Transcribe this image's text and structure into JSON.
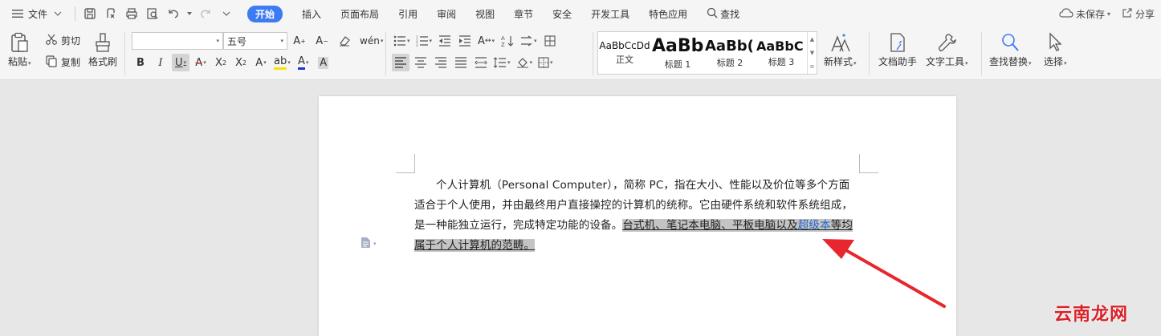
{
  "menubar": {
    "file_label": "文件",
    "tabs": [
      {
        "label": "开始",
        "active": true
      },
      {
        "label": "插入"
      },
      {
        "label": "页面布局"
      },
      {
        "label": "引用"
      },
      {
        "label": "审阅"
      },
      {
        "label": "视图"
      },
      {
        "label": "章节"
      },
      {
        "label": "安全"
      },
      {
        "label": "开发工具"
      },
      {
        "label": "特色应用"
      }
    ],
    "search_label": "查找",
    "unsaved_label": "未保存",
    "share_label": "分享"
  },
  "ribbon": {
    "paste_label": "粘贴",
    "cut_label": "剪切",
    "copy_label": "复制",
    "format_painter_label": "格式刷",
    "font_name_value": "",
    "font_size_value": "五号",
    "styles": [
      {
        "sample": "AaBbCcDd",
        "label": "正文"
      },
      {
        "sample": "AaBb",
        "label": "标题 1"
      },
      {
        "sample": "AaBb(",
        "label": "标题 2"
      },
      {
        "sample": "AaBbC",
        "label": "标题 3"
      }
    ],
    "new_style_label": "新样式",
    "doc_helper_label": "文档助手",
    "text_tools_label": "文字工具",
    "find_replace_label": "查找替换",
    "select_label": "选择"
  },
  "document": {
    "para_normal": "个人计算机（Personal Computer），简称 PC，指在大小、性能以及价位等多个方面适合于个人使用，并由最终用户直接操控的计算机的统称。它由硬件系统和软件系统组成，是一种能独立运行，完成特定功能的设备。",
    "sel_part1": "台式机、笔记本电脑、平板电脑以及",
    "sel_link": "超级本",
    "sel_part2": "等均属于个人计算机的范畴。"
  },
  "watermark": "云南龙网",
  "colors": {
    "accent": "#3d7bf2",
    "selection": "#c4c4c4",
    "link": "#2563c9",
    "arrow": "#e8262d"
  }
}
